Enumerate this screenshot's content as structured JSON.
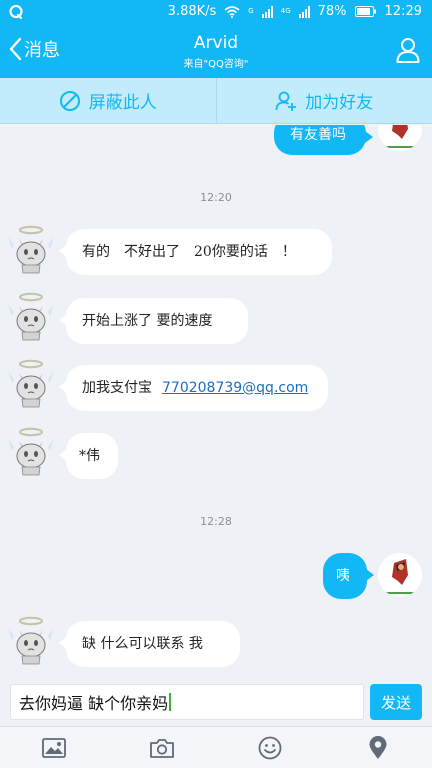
{
  "status_bar": {
    "network_speed": "3.88K/s",
    "signal_label_1": "G",
    "signal_label_2": "4G",
    "battery": "78%",
    "time": "12:29"
  },
  "header": {
    "back_label": "消息",
    "title": "Arvid",
    "subtitle": "来自\"QQ咨询\""
  },
  "actions": {
    "block_label": "屏蔽此人",
    "add_friend_label": "加为好友"
  },
  "messages": {
    "m0": "有友善吗",
    "t1": "12:20",
    "m1": "有的　不好出了　20你要的话　！",
    "m2": "开始上涨了 要的速度",
    "m3_prefix": "加我支付宝",
    "m3_email": "770208739@qq.com",
    "m4": "*伟",
    "t2": "12:28",
    "m5": "咦",
    "m6": "缺 什么可以联系 我"
  },
  "input": {
    "value": "去你妈逼 缺个你亲妈",
    "send_label": "发送"
  },
  "colors": {
    "accent": "#12b7f5",
    "action_bar": "#c2ecfb",
    "chat_bg": "#eef1f5"
  },
  "icons": {
    "toolbar": [
      "image-icon",
      "camera-icon",
      "emoji-icon",
      "location-icon"
    ],
    "header": [
      "chevron-left-icon",
      "person-icon"
    ],
    "actions": [
      "block-icon",
      "add-person-icon"
    ]
  }
}
